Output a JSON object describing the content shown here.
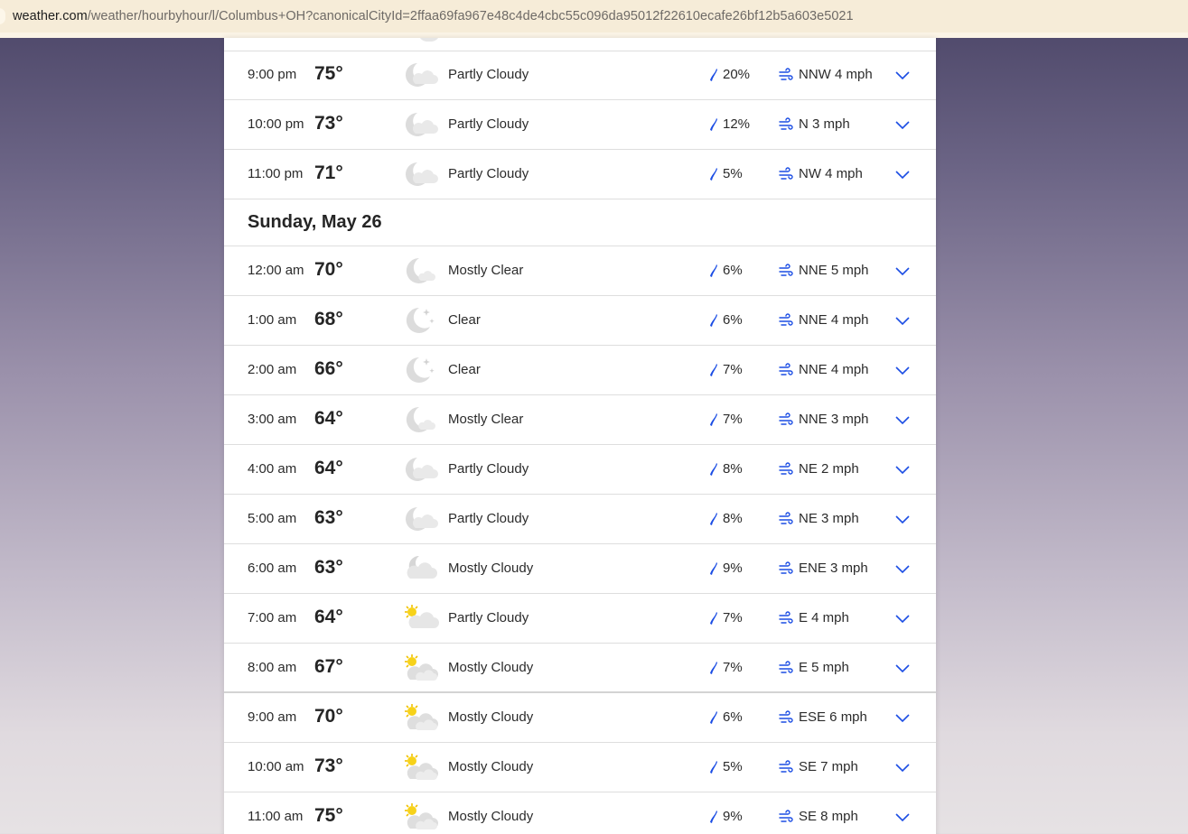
{
  "browser": {
    "url_domain": "weather.com",
    "url_path": "/weather/hourbyhour/l/Columbus+OH?canonicalCityId=2ffaa69fa967e48c4de4cbc55c096da95012f22610ecafe26bf12b5a603e5021"
  },
  "colors": {
    "accent": "#1b4de4",
    "precip_drop": "#1b4de4"
  },
  "hourly": {
    "section_day": "Sunday, May 26",
    "rows_before": [
      {
        "time": "9:00 pm",
        "temp": "75°",
        "icon": "partly-cloudy-night-icon",
        "condition": "Partly Cloudy",
        "precip": "20%",
        "wind": "NNW 4 mph"
      },
      {
        "time": "10:00 pm",
        "temp": "73°",
        "icon": "partly-cloudy-night-icon",
        "condition": "Partly Cloudy",
        "precip": "12%",
        "wind": "N 3 mph"
      },
      {
        "time": "11:00 pm",
        "temp": "71°",
        "icon": "partly-cloudy-night-icon",
        "condition": "Partly Cloudy",
        "precip": "5%",
        "wind": "NW 4 mph"
      }
    ],
    "rows_after": [
      {
        "time": "12:00 am",
        "temp": "70°",
        "icon": "mostly-clear-night-icon",
        "condition": "Mostly Clear",
        "precip": "6%",
        "wind": "NNE 5 mph"
      },
      {
        "time": "1:00 am",
        "temp": "68°",
        "icon": "clear-night-icon",
        "condition": "Clear",
        "precip": "6%",
        "wind": "NNE 4 mph"
      },
      {
        "time": "2:00 am",
        "temp": "66°",
        "icon": "clear-night-icon",
        "condition": "Clear",
        "precip": "7%",
        "wind": "NNE 4 mph"
      },
      {
        "time": "3:00 am",
        "temp": "64°",
        "icon": "mostly-clear-night-icon",
        "condition": "Mostly Clear",
        "precip": "7%",
        "wind": "NNE 3 mph"
      },
      {
        "time": "4:00 am",
        "temp": "64°",
        "icon": "partly-cloudy-night-icon",
        "condition": "Partly Cloudy",
        "precip": "8%",
        "wind": "NE 2 mph"
      },
      {
        "time": "5:00 am",
        "temp": "63°",
        "icon": "partly-cloudy-night-icon",
        "condition": "Partly Cloudy",
        "precip": "8%",
        "wind": "NE 3 mph"
      },
      {
        "time": "6:00 am",
        "temp": "63°",
        "icon": "mostly-cloudy-night-icon",
        "condition": "Mostly Cloudy",
        "precip": "9%",
        "wind": "ENE 3 mph"
      },
      {
        "time": "7:00 am",
        "temp": "64°",
        "icon": "partly-cloudy-day-icon",
        "condition": "Partly Cloudy",
        "precip": "7%",
        "wind": "E 4 mph"
      },
      {
        "time": "8:00 am",
        "temp": "67°",
        "icon": "mostly-cloudy-day-icon",
        "condition": "Mostly Cloudy",
        "precip": "7%",
        "wind": "E 5 mph"
      },
      {
        "time": "9:00 am",
        "temp": "70°",
        "icon": "mostly-cloudy-day-icon",
        "condition": "Mostly Cloudy",
        "precip": "6%",
        "wind": "ESE 6 mph"
      },
      {
        "time": "10:00 am",
        "temp": "73°",
        "icon": "mostly-cloudy-day-icon",
        "condition": "Mostly Cloudy",
        "precip": "5%",
        "wind": "SE 7 mph"
      },
      {
        "time": "11:00 am",
        "temp": "75°",
        "icon": "mostly-cloudy-day-icon",
        "condition": "Mostly Cloudy",
        "precip": "9%",
        "wind": "SE 8 mph"
      }
    ]
  }
}
